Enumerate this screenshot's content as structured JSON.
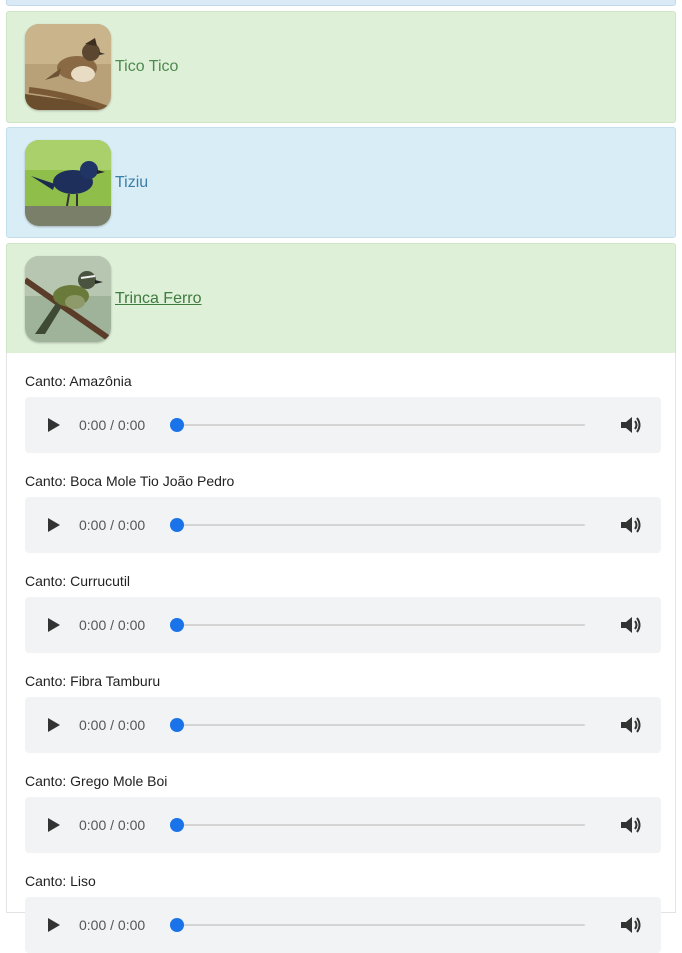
{
  "birds": [
    {
      "name": "Tico Tico"
    },
    {
      "name": "Tiziu"
    },
    {
      "name": "Trinca Ferro"
    }
  ],
  "songs": [
    {
      "label": "Canto: Amazônia",
      "time": "0:00 / 0:00"
    },
    {
      "label": "Canto: Boca Mole Tio João Pedro",
      "time": "0:00 / 0:00"
    },
    {
      "label": "Canto: Currucutil",
      "time": "0:00 / 0:00"
    },
    {
      "label": "Canto: Fibra Tamburu",
      "time": "0:00 / 0:00"
    },
    {
      "label": "Canto: Grego Mole Boi",
      "time": "0:00 / 0:00"
    },
    {
      "label": "Canto: Liso",
      "time": "0:00 / 0:00"
    }
  ],
  "colors": {
    "card_green": "#dff0d8",
    "card_blue": "#d9edf7",
    "player_bg": "#f1f3f4",
    "progress_knob": "#1a73e8"
  },
  "icons": [
    "play-icon",
    "volume-icon"
  ]
}
